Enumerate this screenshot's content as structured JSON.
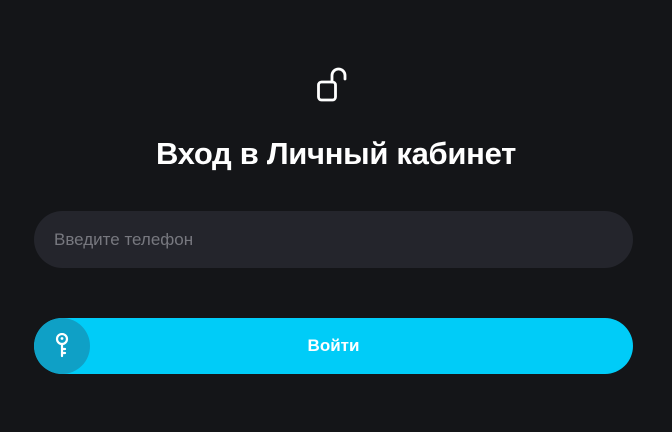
{
  "login": {
    "title": "Вход в Личный кабинет",
    "phone_placeholder": "Введите телефон",
    "phone_value": "",
    "submit_label": "Войти"
  },
  "icons": {
    "header": "unlocked-padlock-icon",
    "button": "key-icon"
  },
  "colors": {
    "background": "#141518",
    "input_bg": "#24252c",
    "accent": "#00ccf8",
    "accent_dark": "#0fa0c6",
    "text": "#ffffff",
    "placeholder": "#77787f"
  }
}
